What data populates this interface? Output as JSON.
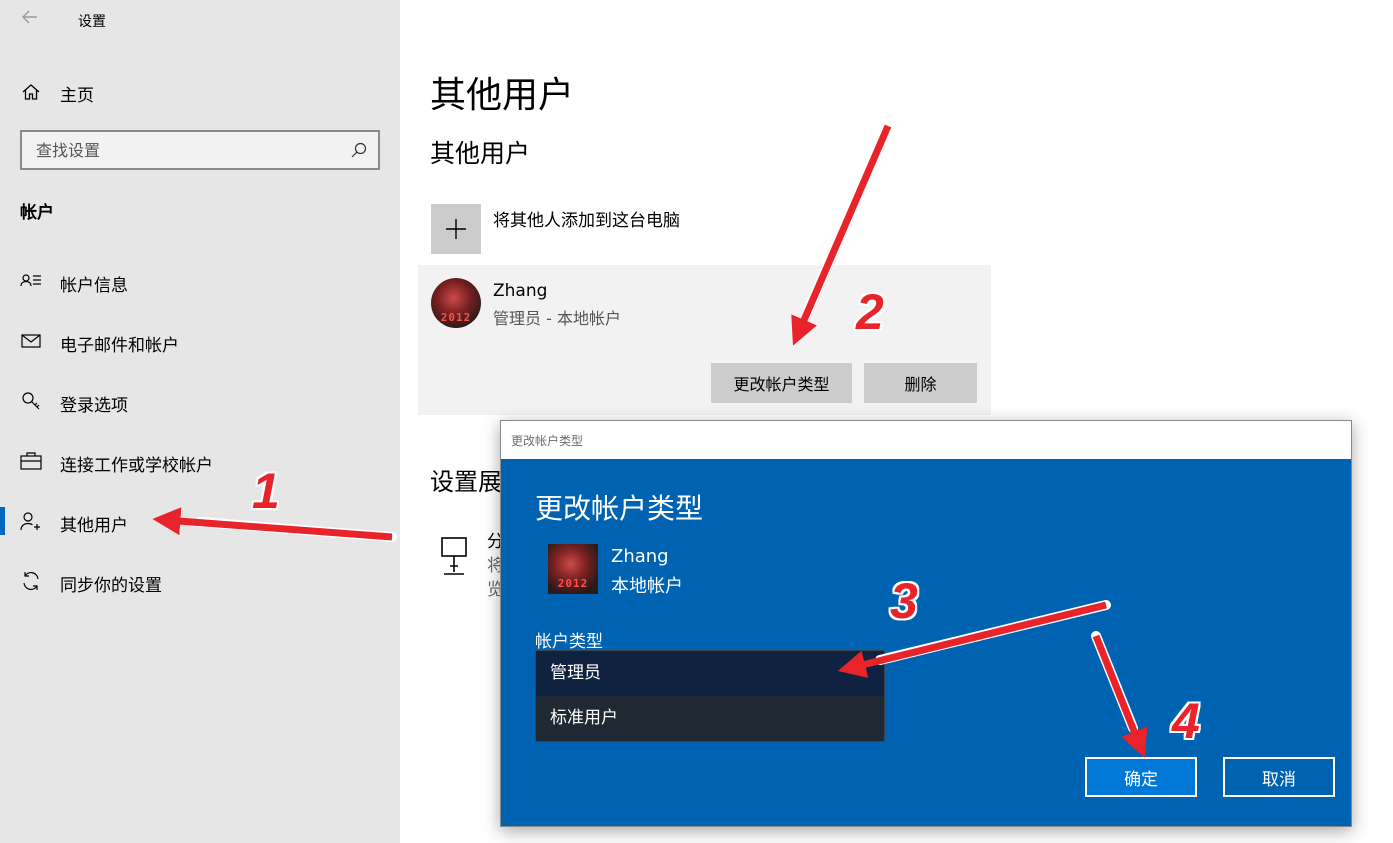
{
  "app": {
    "title": "设置"
  },
  "sidebar": {
    "home_label": "主页",
    "search_placeholder": "查找设置",
    "section_heading": "帐户",
    "items": [
      {
        "label": "帐户信息",
        "icon": "account-info-icon"
      },
      {
        "label": "电子邮件和帐户",
        "icon": "mail-icon"
      },
      {
        "label": "登录选项",
        "icon": "key-icon"
      },
      {
        "label": "连接工作或学校帐户",
        "icon": "briefcase-icon"
      },
      {
        "label": "其他用户",
        "icon": "add-person-icon",
        "active": true
      },
      {
        "label": "同步你的设置",
        "icon": "sync-icon"
      }
    ]
  },
  "main": {
    "page_title": "其他用户",
    "section_title": "其他用户",
    "add_user_label": "将其他人添加到这台电脑",
    "user_card": {
      "name": "Zhang",
      "role": "管理员 - 本地帐户",
      "avatar_text": "2012",
      "change_type_button": "更改帐户类型",
      "delete_button": "删除"
    },
    "kiosk_section_title_partial": "设置展",
    "kiosk_text_lines": [
      "分",
      "将",
      "览"
    ]
  },
  "dialog": {
    "window_title": "更改帐户类型",
    "heading": "更改帐户类型",
    "user_name": "Zhang",
    "user_type": "本地帐户",
    "account_type_label": "帐户类型",
    "options": [
      "管理员",
      "标准用户"
    ],
    "selected_option": "管理员",
    "ok_button": "确定",
    "cancel_button": "取消"
  },
  "annotations": {
    "steps": [
      "1",
      "2",
      "3",
      "4"
    ],
    "arrow_color": "#e8232a"
  },
  "colors": {
    "sidebar_bg": "#e6e6e6",
    "accent": "#0067c0",
    "dialog_bg": "#0063b1",
    "ok_button_bg": "#0078d7"
  }
}
